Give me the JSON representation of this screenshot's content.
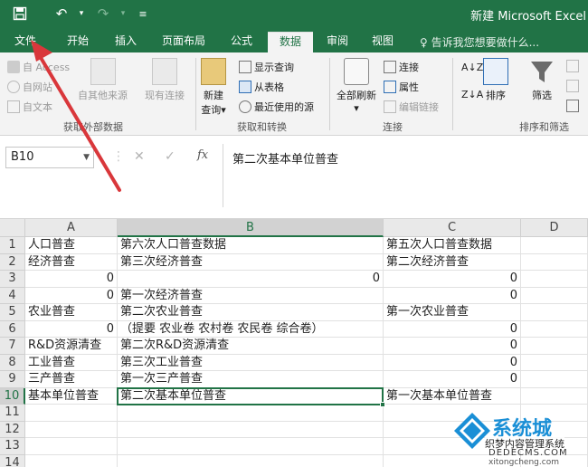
{
  "window": {
    "title": "新建 Microsoft Excel"
  },
  "tabs": [
    {
      "label": "文件"
    },
    {
      "label": "开始"
    },
    {
      "label": "插入"
    },
    {
      "label": "页面布局"
    },
    {
      "label": "公式"
    },
    {
      "label": "数据"
    },
    {
      "label": "审阅"
    },
    {
      "label": "视图"
    }
  ],
  "tell_me": "♀ 告诉我您想要做什么...",
  "ribbon": {
    "get_external": {
      "from_access": "自 Access",
      "from_web": "自网站",
      "from_text": "自文本",
      "from_other": "自其他来源",
      "existing": "现有连接",
      "label": "获取外部数据"
    },
    "get_transform": {
      "new_query_1": "新建",
      "new_query_2": "查询▾",
      "show_queries": "显示查询",
      "from_table": "从表格",
      "recent_sources": "最近使用的源",
      "label": "获取和转换"
    },
    "connections": {
      "refresh_all_1": "全部刷新",
      "refresh_all_2": "▾",
      "connections": "连接",
      "properties": "属性",
      "edit_links": "编辑链接",
      "label": "连接"
    },
    "sort_filter": {
      "sort": "排序",
      "filter": "筛选",
      "label": "排序和筛选"
    }
  },
  "formula_bar": {
    "name_box": "B10",
    "fx": "fx",
    "cancel": "✕",
    "enter": "✓",
    "formula": "第二次基本单位普查"
  },
  "grid": {
    "columns": [
      "A",
      "B",
      "C",
      "D"
    ],
    "selected_cell": "B10",
    "rows": [
      {
        "n": "1",
        "a": "人口普查",
        "b": "第六次人口普查数据",
        "c": "第五次人口普查数据"
      },
      {
        "n": "2",
        "a": "经济普查",
        "b": "第三次经济普查",
        "c": "第二次经济普查"
      },
      {
        "n": "3",
        "a": "",
        "a_num": "0",
        "b": "",
        "b_num": "0",
        "c": "",
        "c_num": "0"
      },
      {
        "n": "4",
        "a": "",
        "a_num": "0",
        "b": "第一次经济普查",
        "c": "",
        "c_num": "0"
      },
      {
        "n": "5",
        "a": "农业普查",
        "b": "第二次农业普查",
        "c": "第一次农业普查"
      },
      {
        "n": "6",
        "a": "",
        "a_num": "0",
        "b": "（提要 农业卷 农村卷 农民卷 综合卷）",
        "c": "",
        "c_num": "0"
      },
      {
        "n": "7",
        "a": "R&D资源清查",
        "b": "第二次R&D资源清查",
        "c": "",
        "c_num": "0"
      },
      {
        "n": "8",
        "a": "工业普查",
        "b": "第三次工业普查",
        "c": "",
        "c_num": "0"
      },
      {
        "n": "9",
        "a": "三产普查",
        "b": "第一次三产普查",
        "c": "",
        "c_num": "0"
      },
      {
        "n": "10",
        "a": "基本单位普查",
        "b": "第二次基本单位普查",
        "c": "第一次基本单位普查"
      },
      {
        "n": "11"
      },
      {
        "n": "12"
      },
      {
        "n": "13"
      },
      {
        "n": "14"
      }
    ]
  },
  "watermark": {
    "brand": "系统城",
    "line1": "织梦内容管理系统",
    "line2": "DEDECMS.COM",
    "line3": "xitongcheng.com"
  },
  "colors": {
    "accent": "#217346",
    "arrow": "#d9373b"
  }
}
